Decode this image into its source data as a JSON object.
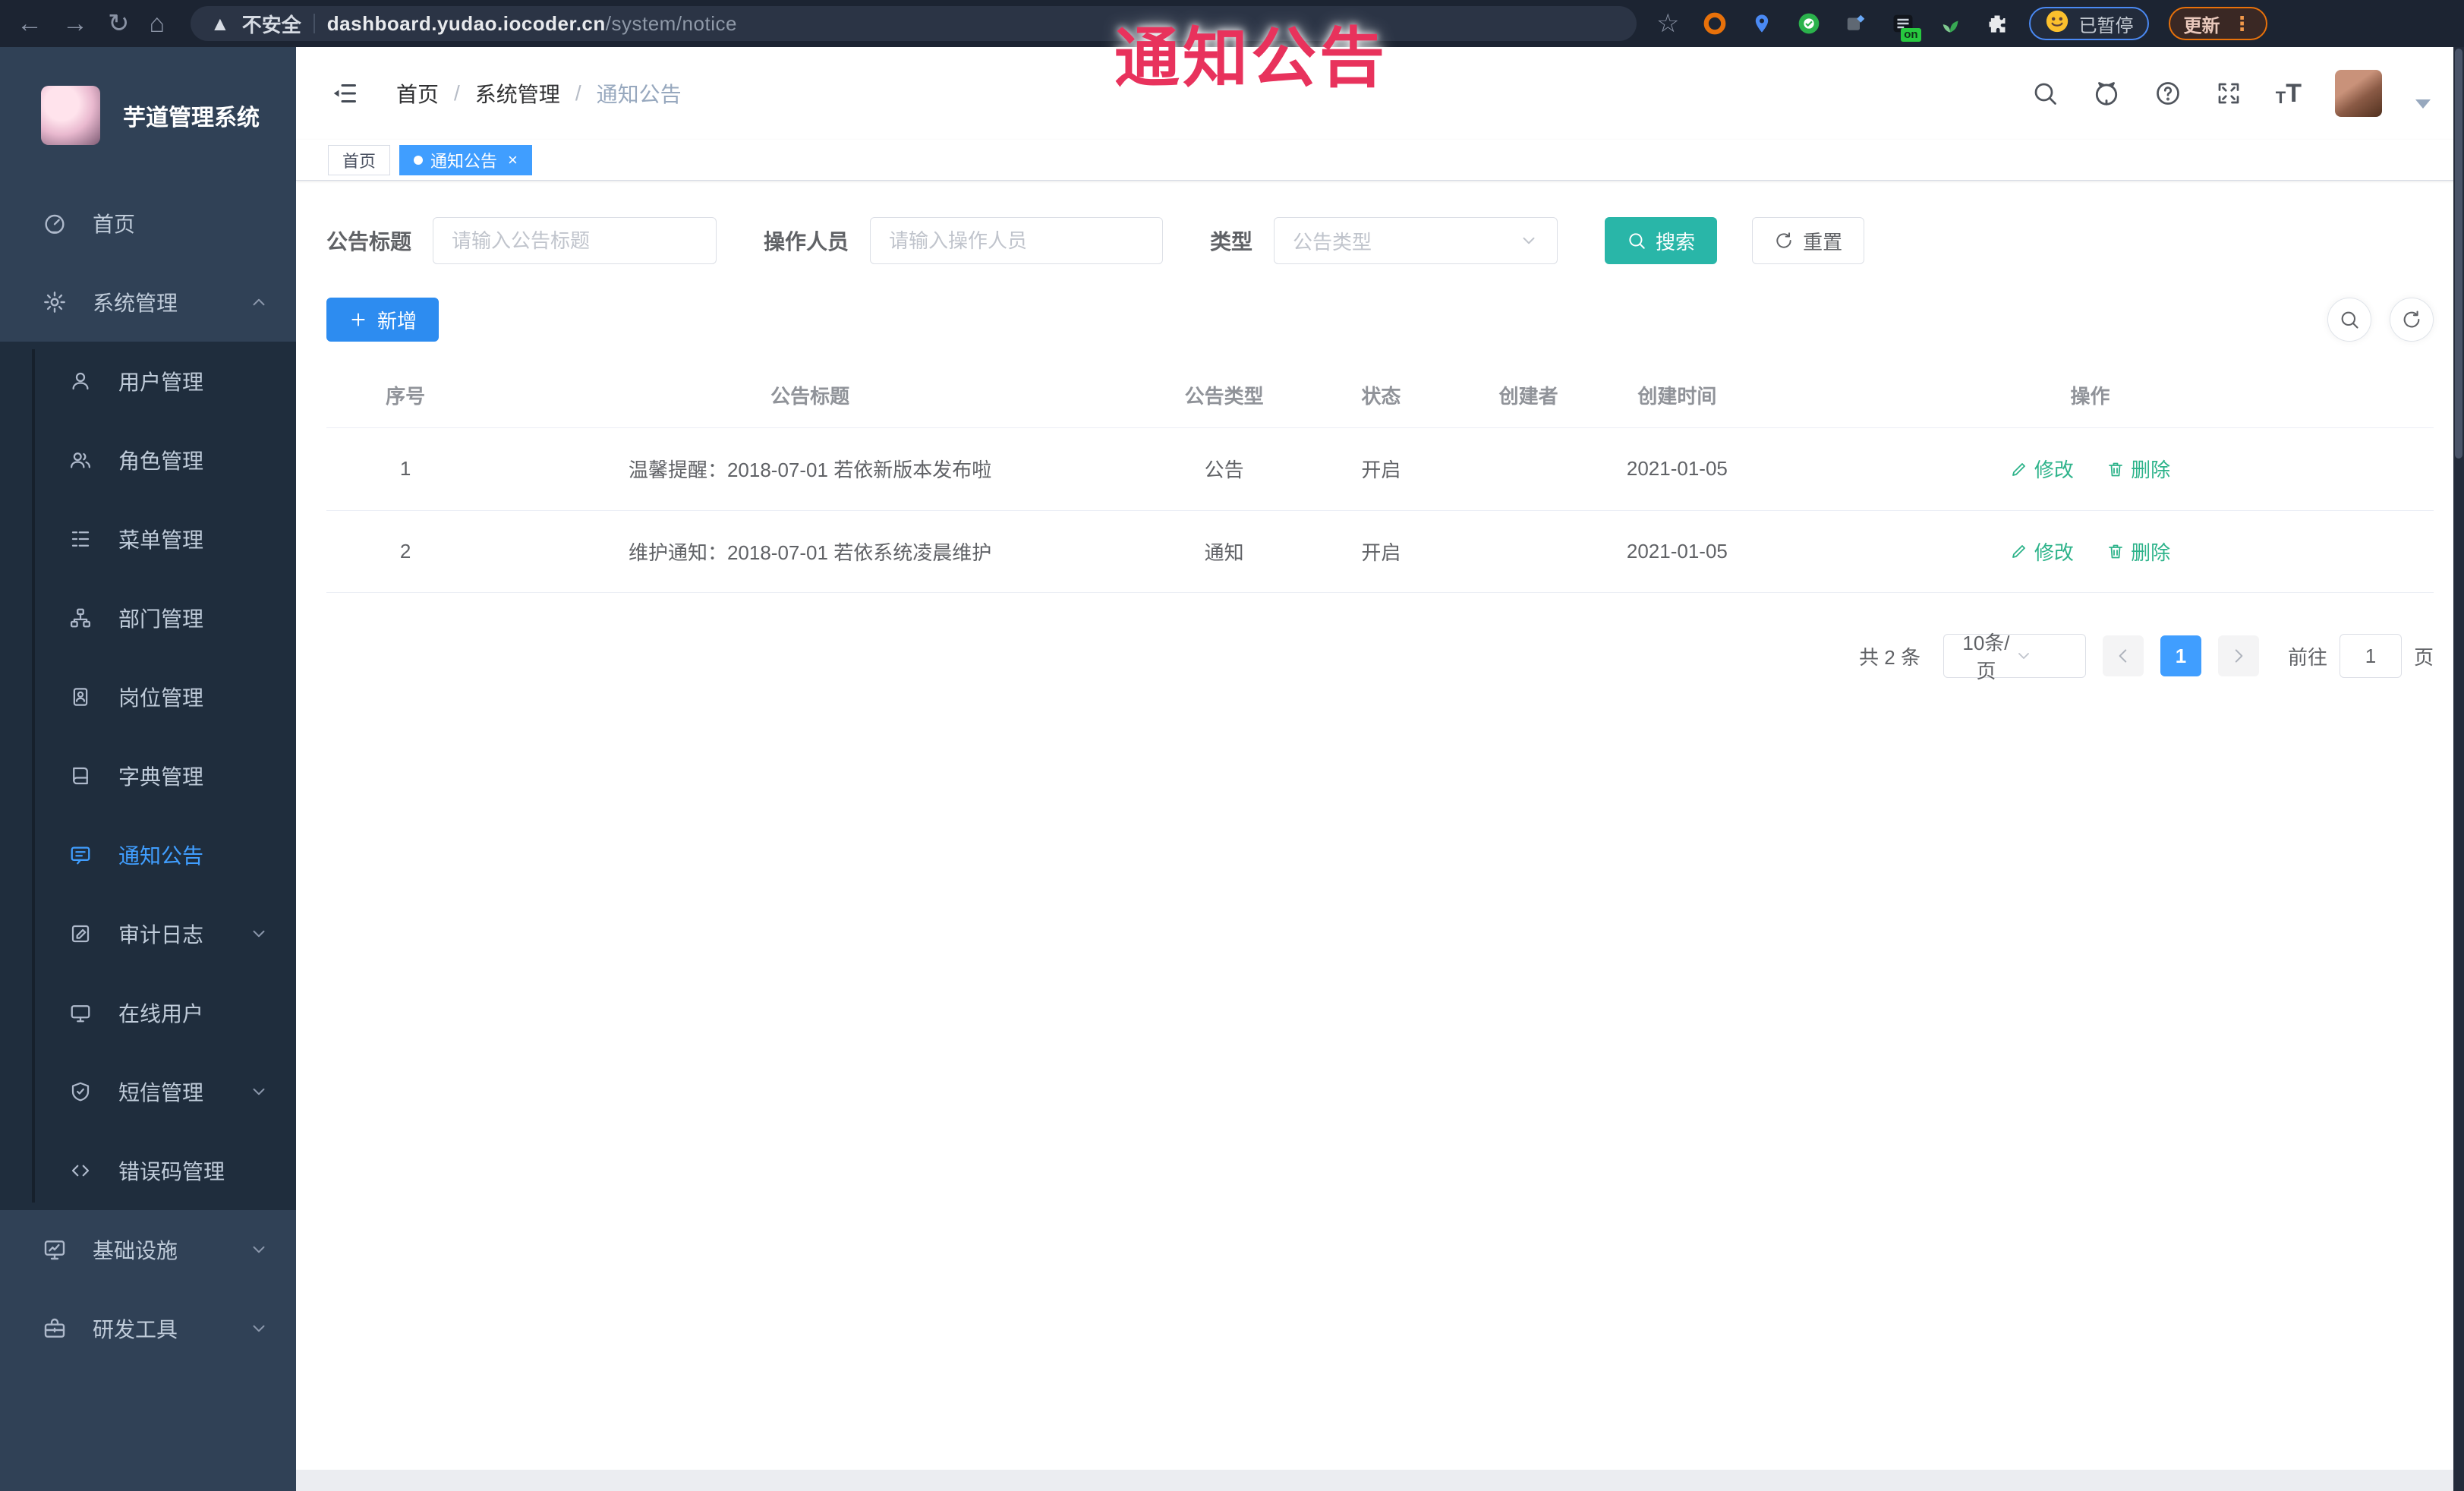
{
  "browser": {
    "security_warning": "不安全",
    "url_domain": "dashboard.yudao.iocoder.cn",
    "url_path": "/system/notice",
    "extension_badge": "on",
    "paused_label": "已暂停",
    "update_label": "更新"
  },
  "annotation": {
    "text": "通知公告",
    "color": "#e8325c"
  },
  "sidebar": {
    "app_title": "芋道管理系统",
    "items": [
      {
        "label": "首页",
        "icon": "dashboard-icon",
        "level": 1
      },
      {
        "label": "系统管理",
        "icon": "gear-icon",
        "level": 1,
        "expanded": true
      },
      {
        "label": "用户管理",
        "icon": "user-icon",
        "level": 2
      },
      {
        "label": "角色管理",
        "icon": "users-icon",
        "level": 2
      },
      {
        "label": "菜单管理",
        "icon": "menu-list-icon",
        "level": 2
      },
      {
        "label": "部门管理",
        "icon": "org-tree-icon",
        "level": 2
      },
      {
        "label": "岗位管理",
        "icon": "badge-icon",
        "level": 2
      },
      {
        "label": "字典管理",
        "icon": "book-icon",
        "level": 2
      },
      {
        "label": "通知公告",
        "icon": "message-icon",
        "level": 2,
        "active": true
      },
      {
        "label": "审计日志",
        "icon": "log-icon",
        "level": 2,
        "has_children": true
      },
      {
        "label": "在线用户",
        "icon": "online-icon",
        "level": 2
      },
      {
        "label": "短信管理",
        "icon": "shield-icon",
        "level": 2,
        "has_children": true
      },
      {
        "label": "错误码管理",
        "icon": "code-icon",
        "level": 2
      },
      {
        "label": "基础设施",
        "icon": "infra-icon",
        "level": 1,
        "has_children": true
      },
      {
        "label": "研发工具",
        "icon": "tools-icon",
        "level": 1,
        "has_children": true
      }
    ]
  },
  "navbar": {
    "breadcrumb": [
      "首页",
      "系统管理",
      "通知公告"
    ],
    "separator": "/"
  },
  "tags": [
    {
      "label": "首页",
      "active": false
    },
    {
      "label": "通知公告",
      "active": true,
      "close": "×"
    }
  ],
  "filters": {
    "title_label": "公告标题",
    "title_placeholder": "请输入公告标题",
    "operator_label": "操作人员",
    "operator_placeholder": "请输入操作人员",
    "type_label": "类型",
    "type_placeholder": "公告类型",
    "search_label": "搜索",
    "reset_label": "重置"
  },
  "toolbar": {
    "add_label": "新增"
  },
  "table": {
    "headers": [
      "序号",
      "公告标题",
      "公告类型",
      "状态",
      "创建者",
      "创建时间",
      "操作"
    ],
    "rows": [
      {
        "no": "1",
        "title": "温馨提醒：2018-07-01 若依新版本发布啦",
        "type": "公告",
        "status": "开启",
        "creator": "",
        "created": "2021-01-05"
      },
      {
        "no": "2",
        "title": "维护通知：2018-07-01 若依系统凌晨维护",
        "type": "通知",
        "status": "开启",
        "creator": "",
        "created": "2021-01-05"
      }
    ],
    "edit_label": "修改",
    "delete_label": "删除"
  },
  "pagination": {
    "total_text": "共 2 条",
    "page_size": "10条/页",
    "current_page": "1",
    "goto_label": "前往",
    "goto_value": "1",
    "page_suffix": "页"
  },
  "colors": {
    "primary_blue": "#409eff",
    "add_button_blue": "#2d8cf0",
    "search_button_teal": "#29b6a8",
    "action_link_green": "#2db38a",
    "sidebar_bg": "#304156",
    "submenu_bg": "#1f2d3d",
    "annotation_red": "#e8325c"
  }
}
